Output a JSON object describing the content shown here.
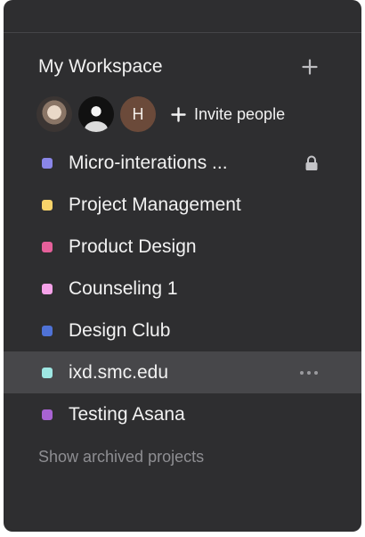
{
  "workspace": {
    "title": "My Workspace",
    "add_icon": "plus-icon"
  },
  "members": {
    "avatars": [
      {
        "kind": "photo",
        "description": "user photo"
      },
      {
        "kind": "photo",
        "description": "user photo"
      },
      {
        "kind": "initial",
        "initial": "H",
        "color": "#6b4a3a"
      }
    ],
    "invite_label": "Invite people",
    "invite_icon": "plus-icon"
  },
  "projects": [
    {
      "name": "Micro-interations ...",
      "color": "#8a86e8",
      "trailing_icon": "lock-icon"
    },
    {
      "name": "Project Management",
      "color": "#f7d36a"
    },
    {
      "name": "Product Design",
      "color": "#e5609a"
    },
    {
      "name": "Counseling 1",
      "color": "#f5a2e8"
    },
    {
      "name": "Design Club",
      "color": "#4f72d6"
    },
    {
      "name": "ixd.smc.edu",
      "color": "#9ee7e3",
      "selected": true,
      "trailing_icon": "more-icon"
    },
    {
      "name": "Testing Asana",
      "color": "#a863d3"
    }
  ],
  "show_archived": "Show archived projects",
  "colors": {
    "panel_bg": "#2e2e30",
    "selected_bg": "#47474a",
    "text": "#f2f2f2",
    "muted": "#8e8e92"
  }
}
